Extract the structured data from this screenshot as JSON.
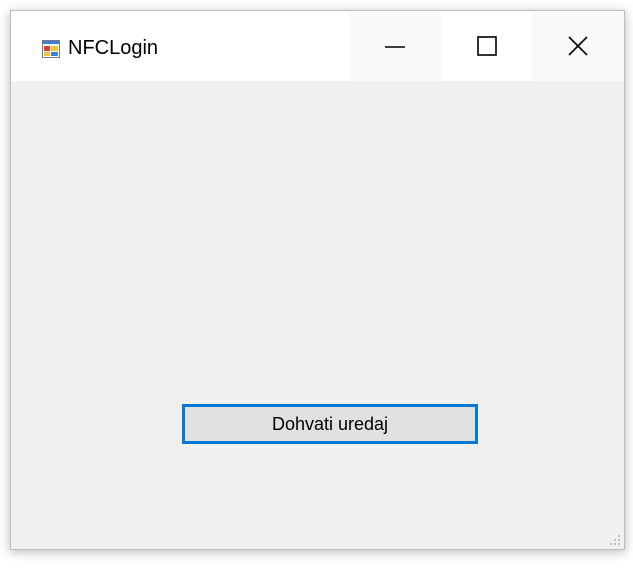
{
  "window": {
    "title": "NFCLogin",
    "icon": "winforms-app-icon"
  },
  "caption_buttons": {
    "minimize_icon": "minimize-icon",
    "maximize_icon": "maximize-icon",
    "close_icon": "close-icon"
  },
  "form": {
    "fetch_device_button_label": "Dohvati uredaj"
  },
  "colors": {
    "accent_focus": "#0078d7",
    "client_background": "#f0f0f0",
    "button_face": "#e1e1e1"
  }
}
